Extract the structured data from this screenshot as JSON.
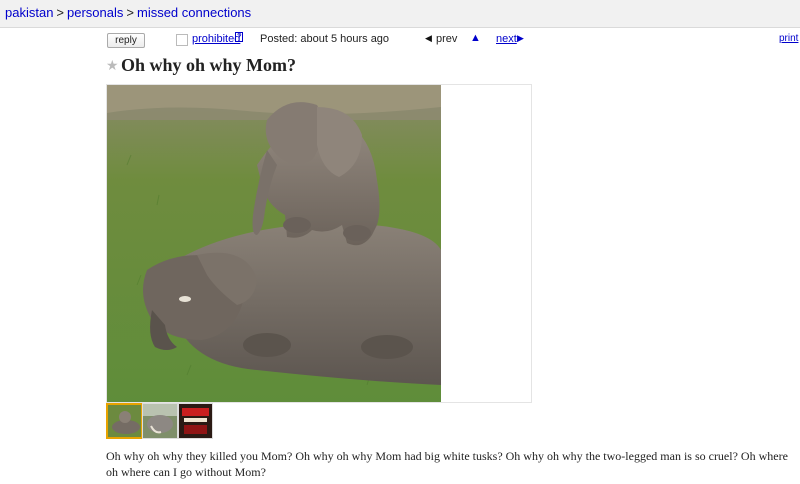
{
  "breadcrumb": {
    "items": [
      "pakistan",
      "personals",
      "missed connections"
    ],
    "separator": ">"
  },
  "actions": {
    "reply_label": "reply",
    "prohibited_label": "prohibited",
    "prohibited_help": "?",
    "posted_text": "Posted: about 5 hours ago",
    "prev_label": "prev",
    "next_label": "next",
    "print_label": "print"
  },
  "post": {
    "title": "Oh why oh why Mom?",
    "body": "Oh why oh why they killed you Mom? Oh why oh why Mom had big white tusks? Oh why oh why the two-legged man is so cruel? Oh where oh where can I go without Mom?",
    "image_alt": "baby elephant lying on mother elephant",
    "thumbnail_count": 3,
    "selected_thumbnail": 1
  },
  "colors": {
    "link": "#0000cc",
    "topbar_bg": "#f1f1f1",
    "thumb_selected_border": "#e8a300"
  }
}
